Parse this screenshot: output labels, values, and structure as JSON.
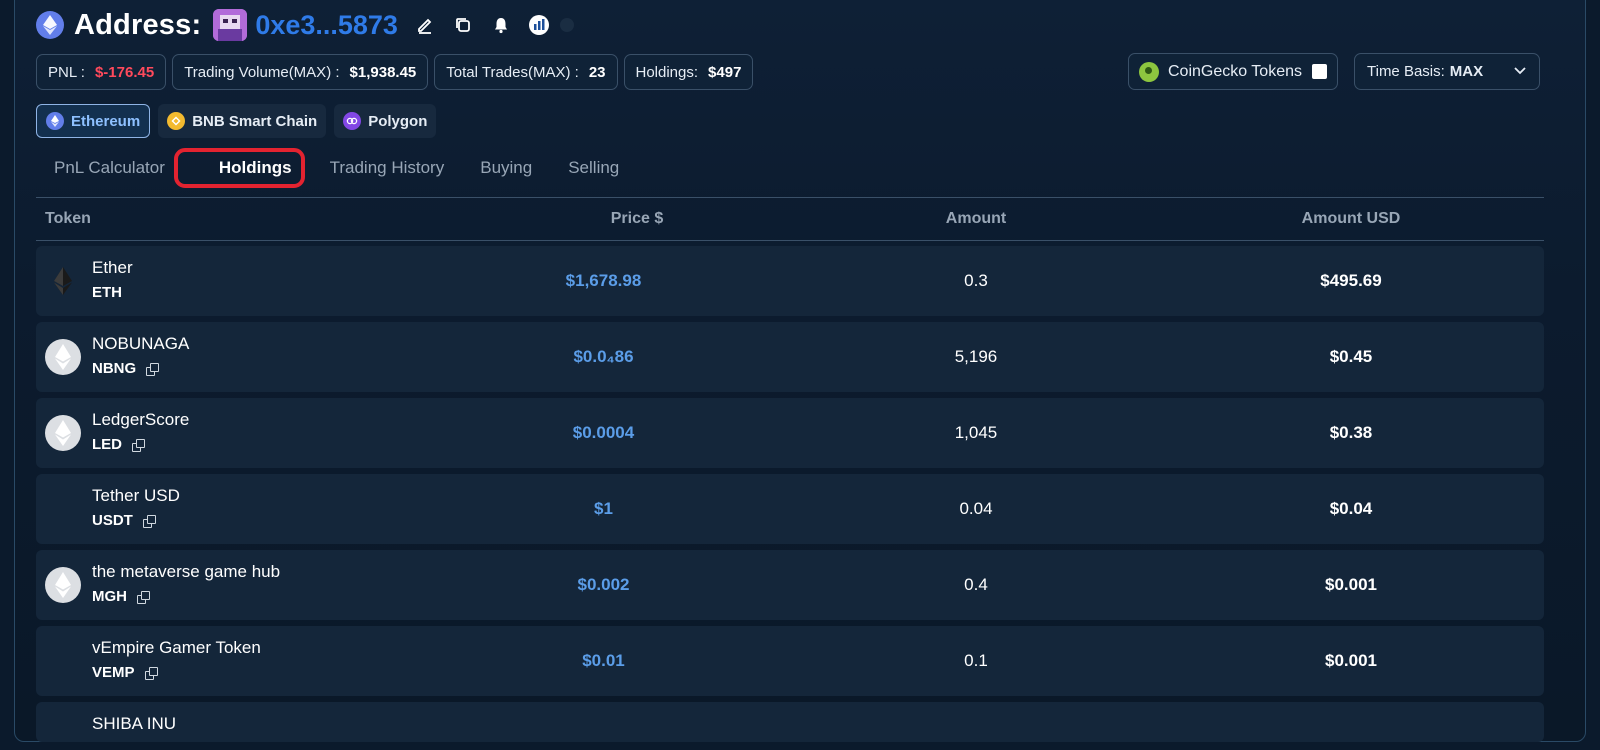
{
  "header": {
    "title": "Address:",
    "address": "0xe3...5873"
  },
  "stats": {
    "pnl_label": "PNL :",
    "pnl_value": "$-176.45",
    "volume_label": "Trading Volume(MAX) :",
    "volume_value": "$1,938.45",
    "trades_label": "Total Trades(MAX) :",
    "trades_value": "23",
    "holdings_label": "Holdings:",
    "holdings_value": "$497"
  },
  "filters": {
    "coingecko_label": "CoinGecko Tokens",
    "time_basis_label": "Time Basis:",
    "time_basis_value": "MAX"
  },
  "chains": [
    {
      "label": "Ethereum",
      "active": true
    },
    {
      "label": "BNB Smart Chain",
      "active": false
    },
    {
      "label": "Polygon",
      "active": false
    }
  ],
  "tabs": [
    "PnL Calculator",
    "Holdings",
    "Trading History",
    "Buying",
    "Selling"
  ],
  "active_tab": "Holdings",
  "table": {
    "columns": [
      "Token",
      "Price $",
      "Amount",
      "Amount USD"
    ],
    "rows": [
      {
        "name": "Ether",
        "symbol": "ETH",
        "price": "$1,678.98",
        "amount": "0.3",
        "usd": "$495.69",
        "icon": "ethereum-diamond-icon"
      },
      {
        "name": "NOBUNAGA",
        "symbol": "NBNG",
        "price": "$0.0₄86",
        "amount": "5,196",
        "usd": "$0.45",
        "icon": "placeholder-eth-icon"
      },
      {
        "name": "LedgerScore",
        "symbol": "LED",
        "price": "$0.0004",
        "amount": "1,045",
        "usd": "$0.38",
        "icon": "placeholder-eth-icon"
      },
      {
        "name": "Tether USD",
        "symbol": "USDT",
        "price": "$1",
        "amount": "0.04",
        "usd": "$0.04",
        "icon": ""
      },
      {
        "name": "the metaverse game hub",
        "symbol": "MGH",
        "price": "$0.002",
        "amount": "0.4",
        "usd": "$0.001",
        "icon": "placeholder-eth-icon"
      },
      {
        "name": "vEmpire Gamer Token",
        "symbol": "VEMP",
        "price": "$0.01",
        "amount": "0.1",
        "usd": "$0.001",
        "icon": ""
      },
      {
        "name": "SHIBA INU",
        "symbol": "",
        "price": "",
        "amount": "",
        "usd": "",
        "icon": ""
      }
    ]
  },
  "colors": {
    "accent": "#2f7be8",
    "negative": "#ff4a5c",
    "price_text": "#5b9de8",
    "highlight_box": "#e32330"
  }
}
